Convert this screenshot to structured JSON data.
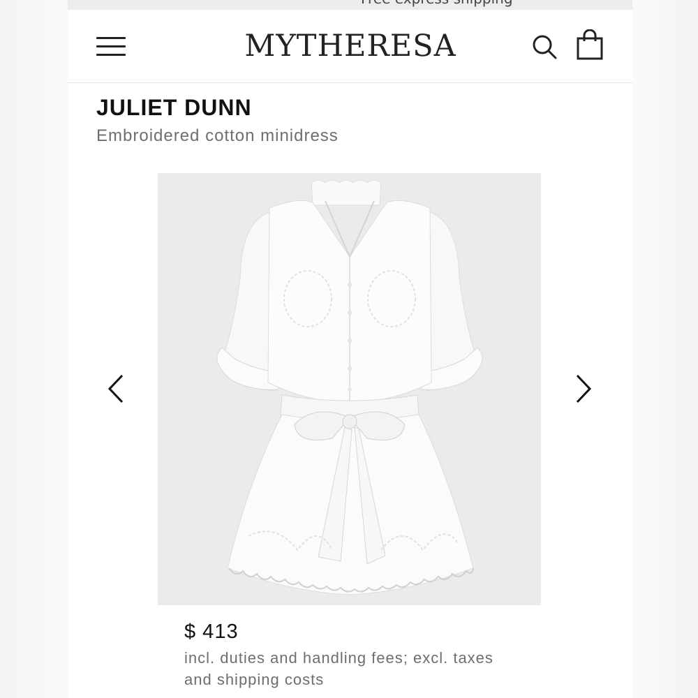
{
  "top_banner": {
    "text": "Free express shipping"
  },
  "header": {
    "logo": "MYTHERESA",
    "menu_icon": "hamburger-menu-icon",
    "search_icon": "search-icon",
    "bag_icon": "shopping-bag-icon"
  },
  "product": {
    "brand": "JULIET DUNN",
    "name": "Embroidered cotton minidress",
    "price": "$ 413",
    "price_note": "incl. duties and handling fees; excl. taxes and shipping costs",
    "image_alt": "White embroidered cotton minidress with tie waist",
    "prev_icon": "chevron-left-icon",
    "next_icon": "chevron-right-icon"
  },
  "colors": {
    "accent": "#222222",
    "image_background": "#ebebeb",
    "secondary_text": "#6e6e6e"
  }
}
